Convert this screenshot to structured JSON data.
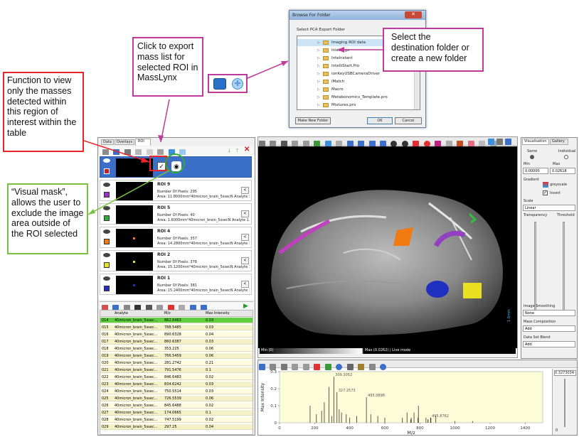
{
  "callouts": {
    "function_view": "Function to view only the masses detected within this region of interest within the table",
    "export": "Click to export mass list for selected ROI in MassLynx",
    "destination": "Select the destination folder or create a new folder",
    "visual_mask": "“Visual mask”, allows the user to exclude the image area outside of the ROI selected"
  },
  "dialog": {
    "title": "Browse For Folder",
    "prompt": "Select PCA Export Folder",
    "folders": [
      "Imaging ROI data",
      "InletLogs",
      "Intelnstant",
      "IntelliStart.Pro",
      "ionKeyUSBCameraDriver",
      "iMatch",
      "Macro",
      "Metabonomics_Template.pro",
      "Mixtures.pro"
    ],
    "make_new_folder": "Make New Folder",
    "ok": "OK",
    "cancel": "Cancel"
  },
  "left_panel": {
    "tabs": [
      "Data",
      "Overlays",
      "ROI"
    ],
    "rois": [
      {
        "name": "ROI 9",
        "pixels": "Number Of Pixels: 295",
        "area": "Area: 11.8000mm²40micron_brain_5ssecN Analyte 1.raw,",
        "color": "#9b30c8",
        "dot": null
      },
      {
        "name": "ROI 5",
        "pixels": "Number Of Pixels: 40",
        "area": "Area: 1.6000mm²40micron_brain_5ssecN Analyte 1.raw,D",
        "color": "#2eaa3c",
        "dot": null
      },
      {
        "name": "ROI 4",
        "pixels": "Number Of Pixels: 357",
        "area": "Area: 14.2800mm²40micron_brain_5ssecN Analyte 1.raw,",
        "color": "#f07a10",
        "dot": "#f07a10"
      },
      {
        "name": "ROI 2",
        "pixels": "Number Of Pixels: 378",
        "area": "Area: 15.1200mm²40micron_brain_5ssecN Analyte 1.raw,",
        "color": "#e8e020",
        "dot": "#e8e020"
      },
      {
        "name": "ROI 1",
        "pixels": "Number Of Pixels: 381",
        "area": "Area: 15.2400mm²40micron_brain_5ssecN Analyte 1.raw,",
        "color": "#2030c0",
        "dot": "#2030c0"
      }
    ],
    "table_headers": [
      "Analyte",
      "M/z",
      "Max Intensity"
    ],
    "table_rows": [
      [
        "014",
        "40micron_brain_5ssec...",
        "862.6463",
        "0.03"
      ],
      [
        "015",
        "40micron_brain_5ssec...",
        "788.5485",
        "0.03"
      ],
      [
        "016",
        "40micron_brain_5ssec...",
        "890.6328",
        "0.04"
      ],
      [
        "017",
        "40micron_brain_5ssec...",
        "860.6387",
        "0.03"
      ],
      [
        "018",
        "40micron_brain_5ssec...",
        "353.225",
        "0.06"
      ],
      [
        "019",
        "40micron_brain_5ssec...",
        "766.5459",
        "0.06"
      ],
      [
        "020",
        "40micron_brain_5ssec...",
        "281.2742",
        "0.21"
      ],
      [
        "021",
        "40micron_brain_5ssec...",
        "791.5476",
        "0.1"
      ],
      [
        "022",
        "40micron_brain_5ssec...",
        "846.6483",
        "0.02"
      ],
      [
        "023",
        "40micron_brain_5ssec...",
        "834.6242",
        "0.03"
      ],
      [
        "024",
        "40micron_brain_5ssec...",
        "750.5514",
        "0.03"
      ],
      [
        "025",
        "40micron_brain_5ssec...",
        "726.5539",
        "0.06"
      ],
      [
        "026",
        "40micron_brain_5ssec...",
        "845.6488",
        "0.02"
      ],
      [
        "027",
        "40micron_brain_5ssec...",
        "174.0665",
        "0.1"
      ],
      [
        "028",
        "40micron_brain_5ssec...",
        "747.5199",
        "0.02"
      ],
      [
        "029",
        "40micron_brain_5ssec...",
        "297.25",
        "0.04"
      ]
    ]
  },
  "image_view": {
    "min_label": "Min (0)",
    "max_label": "Max (0.0262) | Live mode",
    "scale_bar": "1.0mm"
  },
  "right_panel": {
    "tabs": [
      "Visualisation",
      "Gallery"
    ],
    "same": "Same",
    "individual": "Individual",
    "min": "Min",
    "max": "Max",
    "min_value": "0.00000",
    "max_value": "0.02618",
    "gradient": "Gradient",
    "gradient_name": "greyscale",
    "invert": "Invert",
    "scale": "Scale",
    "scale_value": "Linear",
    "transparency": "Transparency",
    "threshold": "Threshold",
    "image_smoothing": "Image Smoothing",
    "smoothing_value": "None",
    "mass_composition": "Mass Composition",
    "mass_value": "Add",
    "data_set_blend": "Data Set Blend",
    "blend_value": "Add"
  },
  "spectrum": {
    "ylabel": "Max Intensity",
    "xlabel": "M/z",
    "yticks": [
      "0.3",
      "0.2",
      "0.1",
      "0"
    ],
    "xticks": [
      "0",
      "200",
      "400",
      "600",
      "800",
      "1000",
      "1200",
      "1400"
    ],
    "annotations": [
      "309.3052",
      "327.2573",
      "495.0898",
      "495.8762"
    ],
    "side_value": "0.3273034",
    "side_zero": "0"
  },
  "chart_data": {
    "type": "bar",
    "xlabel": "M/z",
    "ylabel": "Max Intensity",
    "xlim": [
      0,
      1500
    ],
    "ylim": [
      0,
      0.3
    ],
    "x": [
      174.07,
      210,
      240,
      255,
      281.27,
      297.25,
      309.31,
      327.26,
      340,
      353.23,
      380,
      400,
      440,
      495.09,
      520,
      560,
      600,
      700,
      726.55,
      747.52,
      750.55,
      766.55,
      788.55,
      791.55,
      834.62,
      845.65,
      846.65,
      860.64,
      862.65,
      890.63,
      1000,
      1100
    ],
    "values": [
      0.1,
      0.05,
      0.07,
      0.12,
      0.21,
      0.04,
      0.27,
      0.18,
      0.08,
      0.06,
      0.05,
      0.03,
      0.04,
      0.15,
      0.05,
      0.04,
      0.03,
      0.03,
      0.06,
      0.02,
      0.03,
      0.06,
      0.03,
      0.1,
      0.03,
      0.02,
      0.02,
      0.03,
      0.03,
      0.04,
      0.01,
      0.01
    ]
  },
  "colors": {
    "callout_magenta": "#c0399c",
    "callout_red": "#e8262a",
    "callout_green": "#7ac143",
    "roi_selected": "#3c6fc8"
  }
}
